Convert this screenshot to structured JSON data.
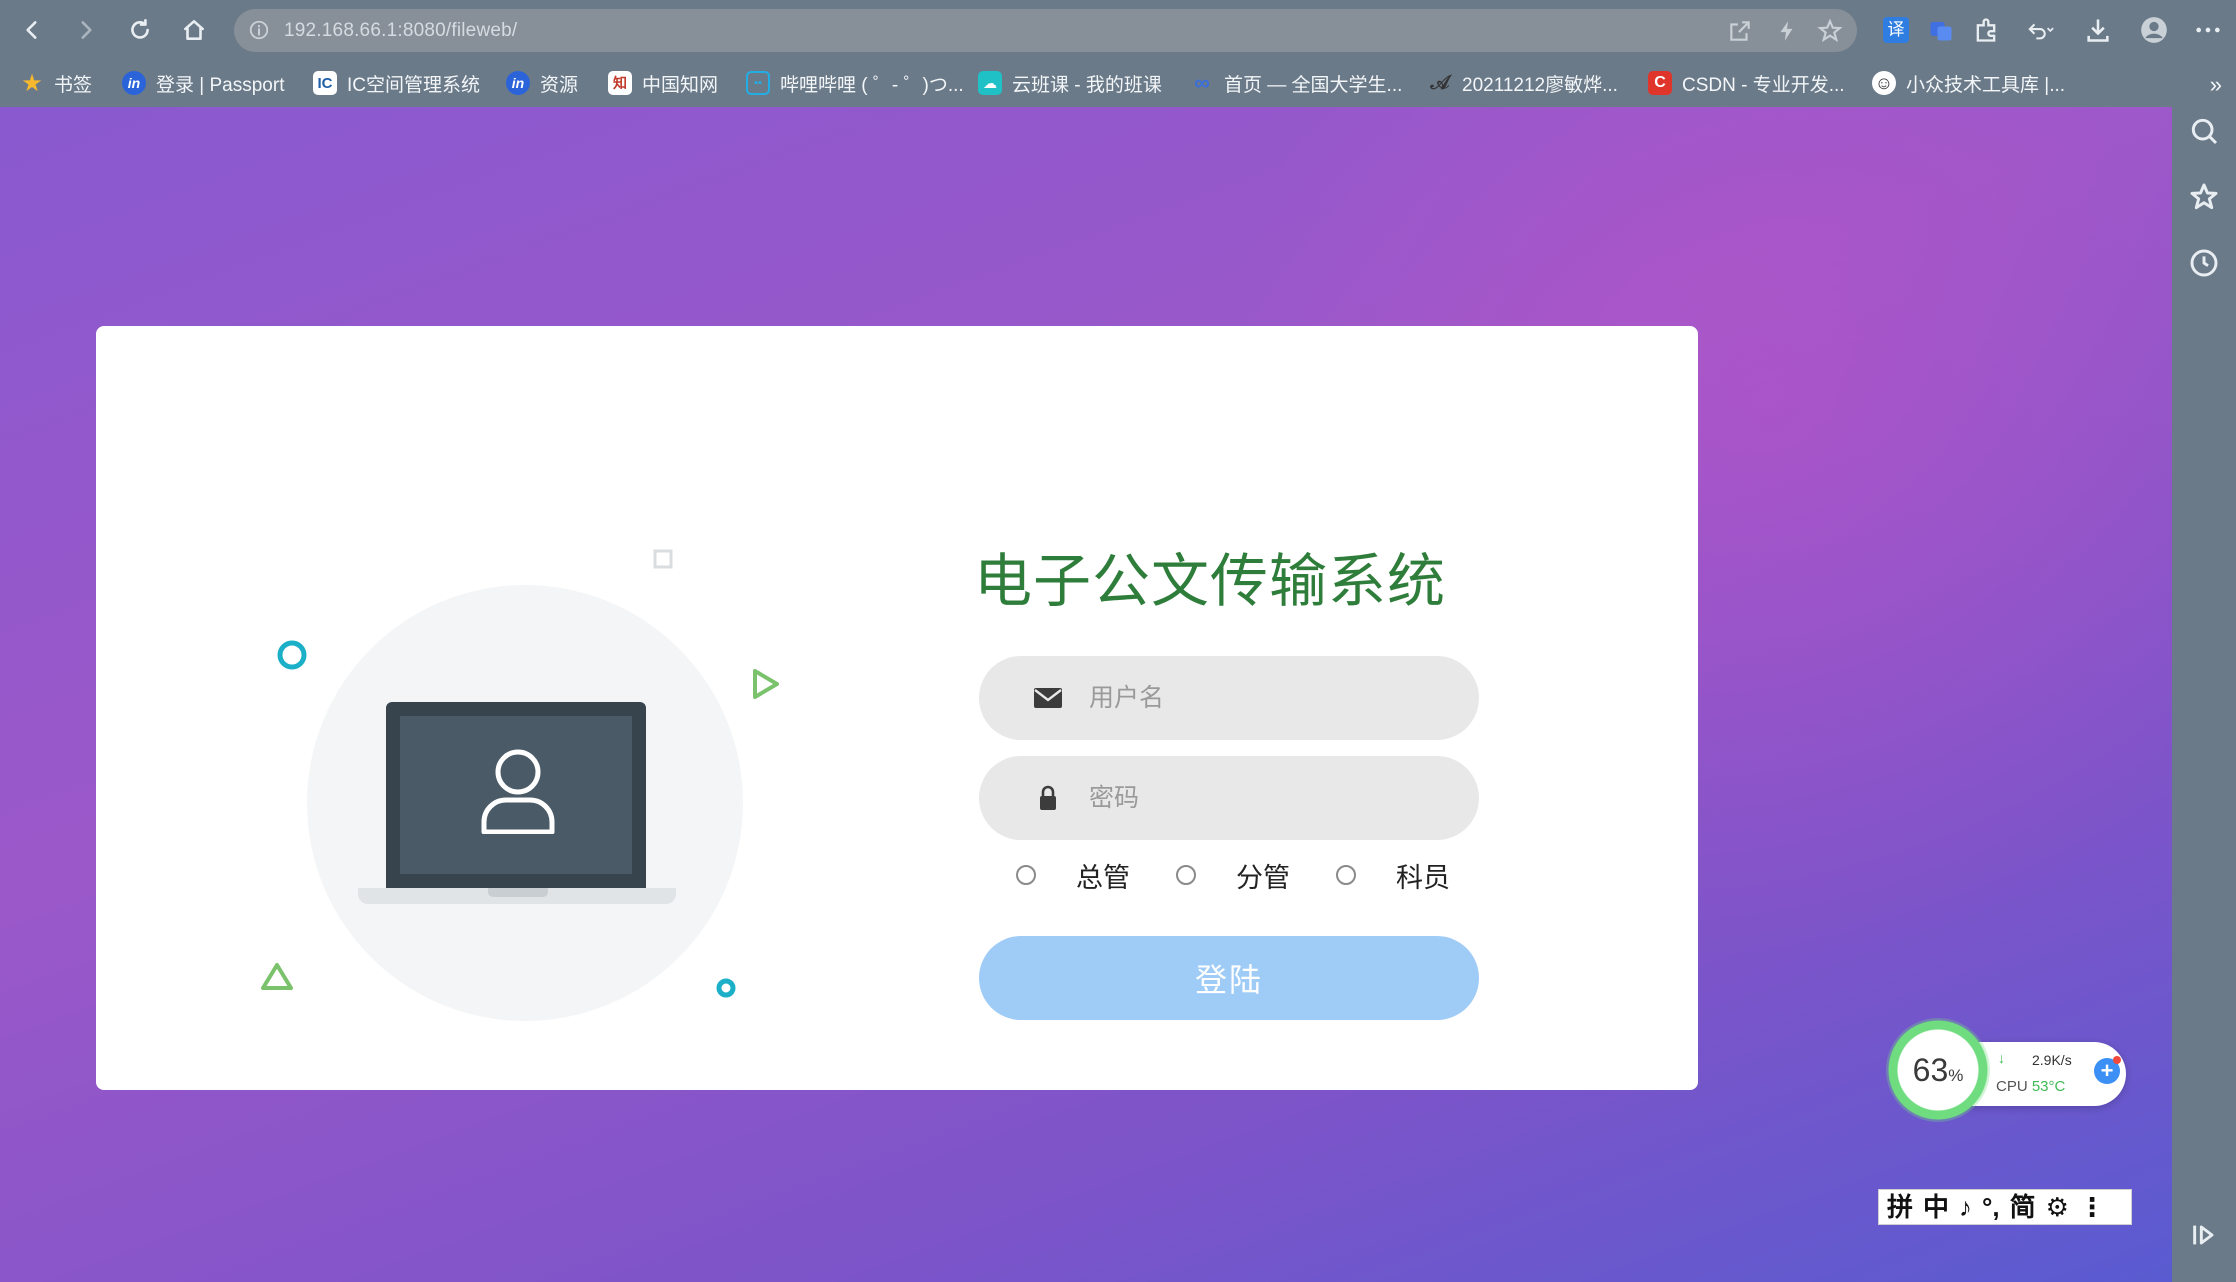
{
  "browser": {
    "url": "192.168.66.1:8080/fileweb/",
    "translate_label": "译"
  },
  "bookmarks": [
    {
      "label": "书签",
      "icon": "star-icon",
      "color": "#f5b82e"
    },
    {
      "label": "登录 | Passport",
      "icon": "in",
      "color": "#2b63d9"
    },
    {
      "label": "IC空间管理系统",
      "icon": "IC",
      "color": "#1f5ea8"
    },
    {
      "label": "资源",
      "icon": "in",
      "color": "#2b63d9"
    },
    {
      "label": "中国知网",
      "icon": "知",
      "color": "#c0392b"
    },
    {
      "label": "哔哩哔哩 ( ゜- ゜)つ...",
      "icon": "tv",
      "color": "#23ade5"
    },
    {
      "label": "云班课 - 我的班课",
      "icon": "云",
      "color": "#1fc1c7"
    },
    {
      "label": "首页 — 全国大学生...",
      "icon": "∞",
      "color": "#3b6fd9"
    },
    {
      "label": "20211212廖敏烨...",
      "icon": "A",
      "color": "#444444"
    },
    {
      "label": "CSDN - 专业开发...",
      "icon": "C",
      "color": "#e0352b"
    },
    {
      "label": "小众技术工具库 |...",
      "icon": "☺",
      "color": "#333333"
    }
  ],
  "login": {
    "title": "电子公文传输系统",
    "username_placeholder": "用户名",
    "password_placeholder": "密码",
    "roles": [
      "总管",
      "分管",
      "科员"
    ],
    "submit_label": "登陆"
  },
  "perf_widget": {
    "memory_value": "63",
    "memory_unit": "%",
    "net_speed": "2.9K/s",
    "cpu_label": "CPU",
    "cpu_temp": "53°C",
    "plus_label": "+"
  },
  "ime": {
    "items": [
      "拼",
      "中",
      "♪",
      "°,",
      "简",
      "⚙",
      "⋮"
    ]
  },
  "colors": {
    "title": "#2e7d3a",
    "button": "#9fcbf7",
    "accent_teal": "#1cb0c8",
    "accent_green": "#7ac26b"
  }
}
